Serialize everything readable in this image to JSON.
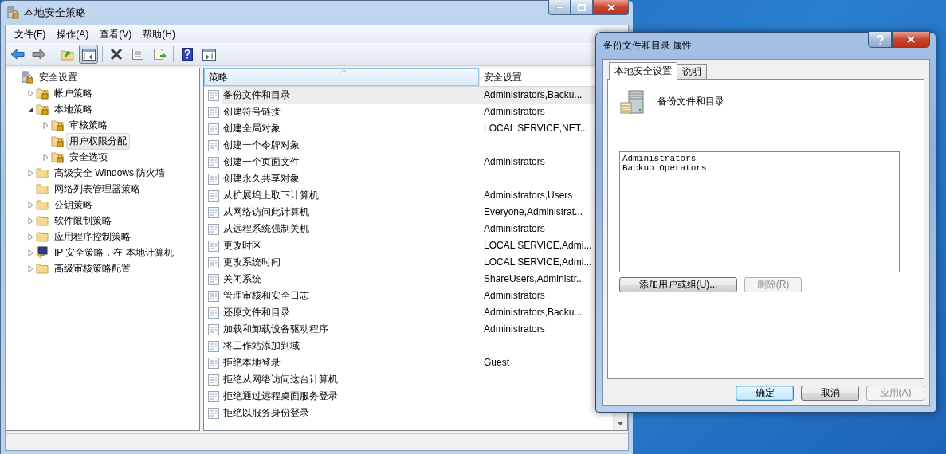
{
  "window": {
    "title": "本地安全策略",
    "controls": [
      {
        "kind": "minimize"
      },
      {
        "kind": "maximize"
      },
      {
        "kind": "close"
      }
    ]
  },
  "menu": [
    "文件(F)",
    "操作(A)",
    "查看(V)",
    "帮助(H)"
  ],
  "toolbar": [
    {
      "kind": "back",
      "pressed": false
    },
    {
      "kind": "forward",
      "pressed": false
    },
    {
      "kind": "sep"
    },
    {
      "kind": "up",
      "pressed": false
    },
    {
      "kind": "tree",
      "pressed": true
    },
    {
      "kind": "sep"
    },
    {
      "kind": "delete",
      "pressed": false
    },
    {
      "kind": "properties",
      "pressed": false
    },
    {
      "kind": "export",
      "pressed": false
    },
    {
      "kind": "sep"
    },
    {
      "kind": "help",
      "pressed": false
    },
    {
      "kind": "actions",
      "pressed": false
    }
  ],
  "tree": [
    {
      "label": "安全设置",
      "kind": "root",
      "selected": false,
      "children": [
        {
          "label": "帐户策略",
          "kind": "locked",
          "expanded": false,
          "selected": false
        },
        {
          "label": "本地策略",
          "kind": "locked",
          "expanded": true,
          "selected": false,
          "children": [
            {
              "label": "审核策略",
              "kind": "locked",
              "expanded": false,
              "selected": false
            },
            {
              "label": "用户权限分配",
              "kind": "locked",
              "selected": true
            },
            {
              "label": "安全选项",
              "kind": "locked",
              "expanded": false,
              "selected": false
            }
          ]
        },
        {
          "label": "高级安全 Windows 防火墙",
          "kind": "folder",
          "expanded": false,
          "selected": false
        },
        {
          "label": "网络列表管理器策略",
          "kind": "folder",
          "selected": false
        },
        {
          "label": "公钥策略",
          "kind": "folder",
          "expanded": false,
          "selected": false
        },
        {
          "label": "软件限制策略",
          "kind": "folder",
          "expanded": false,
          "selected": false
        },
        {
          "label": "应用程序控制策略",
          "kind": "folder",
          "expanded": false,
          "selected": false
        },
        {
          "label": "IP 安全策略，在 本地计算机",
          "kind": "ip",
          "expanded": false,
          "selected": false
        },
        {
          "label": "高级审核策略配置",
          "kind": "folder",
          "expanded": false,
          "selected": false
        }
      ]
    }
  ],
  "table": {
    "columns": [
      "策略",
      "安全设置"
    ],
    "rows": [
      {
        "policy": "备份文件和目录",
        "setting": "Administrators,Backu...",
        "selected": true
      },
      {
        "policy": "创建符号链接",
        "setting": "Administrators",
        "selected": false
      },
      {
        "policy": "创建全局对象",
        "setting": "LOCAL SERVICE,NET...",
        "selected": false
      },
      {
        "policy": "创建一个令牌对象",
        "selected": false
      },
      {
        "policy": "创建一个页面文件",
        "setting": "Administrators",
        "selected": false
      },
      {
        "policy": "创建永久共享对象",
        "selected": false
      },
      {
        "policy": "从扩展坞上取下计算机",
        "setting": "Administrators,Users",
        "selected": false
      },
      {
        "policy": "从网络访问此计算机",
        "setting": "Everyone,Administrat...",
        "selected": false
      },
      {
        "policy": "从远程系统强制关机",
        "setting": "Administrators",
        "selected": false
      },
      {
        "policy": "更改时区",
        "setting": "LOCAL SERVICE,Admi...",
        "selected": false
      },
      {
        "policy": "更改系统时间",
        "setting": "LOCAL SERVICE,Admi...",
        "selected": false
      },
      {
        "policy": "关闭系统",
        "setting": "ShareUsers,Administr...",
        "selected": false
      },
      {
        "policy": "管理审核和安全日志",
        "setting": "Administrators",
        "selected": false
      },
      {
        "policy": "还原文件和目录",
        "setting": "Administrators,Backu...",
        "selected": false
      },
      {
        "policy": "加载和卸载设备驱动程序",
        "setting": "Administrators",
        "selected": false
      },
      {
        "policy": "将工作站添加到域",
        "selected": false
      },
      {
        "policy": "拒绝本地登录",
        "setting": "Guest",
        "selected": false
      },
      {
        "policy": "拒绝从网络访问这台计算机",
        "selected": false
      },
      {
        "policy": "拒绝通过远程桌面服务登录",
        "selected": false
      },
      {
        "policy": "拒绝以服务身份登录",
        "selected": false
      }
    ]
  },
  "dialog": {
    "title": "备份文件和目录 属性",
    "tabs": [
      {
        "label": "本地安全设置",
        "selected": true
      },
      {
        "label": "说明",
        "selected": false
      }
    ],
    "policy_name": "备份文件和目录",
    "members": [
      "Administrators",
      "Backup Operators"
    ],
    "list_buttons": [
      {
        "label": "添加用户或组(U)...",
        "disabled": false
      },
      {
        "label": "删除(R)",
        "disabled": true
      }
    ],
    "buttons": [
      {
        "label": "确定",
        "disabled": false,
        "default": true
      },
      {
        "label": "取消",
        "disabled": false,
        "default": false
      },
      {
        "label": "应用(A)",
        "disabled": true,
        "default": false
      }
    ]
  }
}
